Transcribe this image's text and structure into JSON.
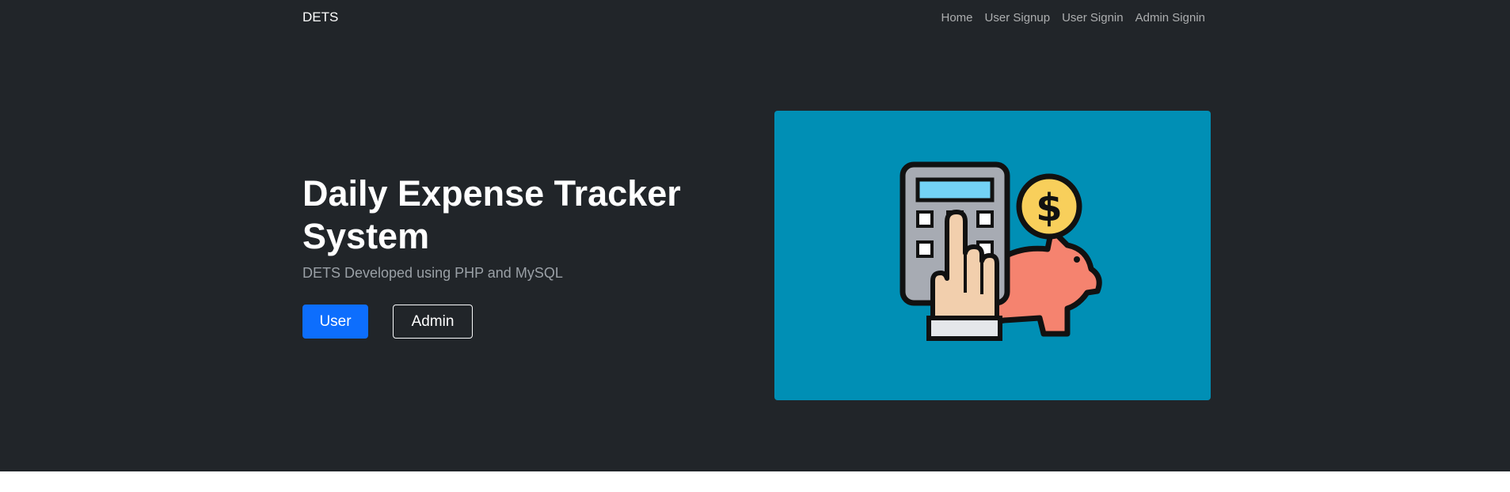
{
  "navbar": {
    "brand": "DETS",
    "links": [
      "Home",
      "User Signup",
      "User Signin",
      "Admin Signin"
    ]
  },
  "hero": {
    "title": "Daily Expense Tracker System",
    "subtitle": "DETS Developed using PHP and MySQL",
    "buttons": {
      "user": "User",
      "admin": "Admin"
    },
    "illustration_icon": "calculator-piggybank-icon"
  },
  "colors": {
    "background_dark": "#212529",
    "primary": "#0d6efd",
    "hero_image_bg": "#008fb5"
  }
}
